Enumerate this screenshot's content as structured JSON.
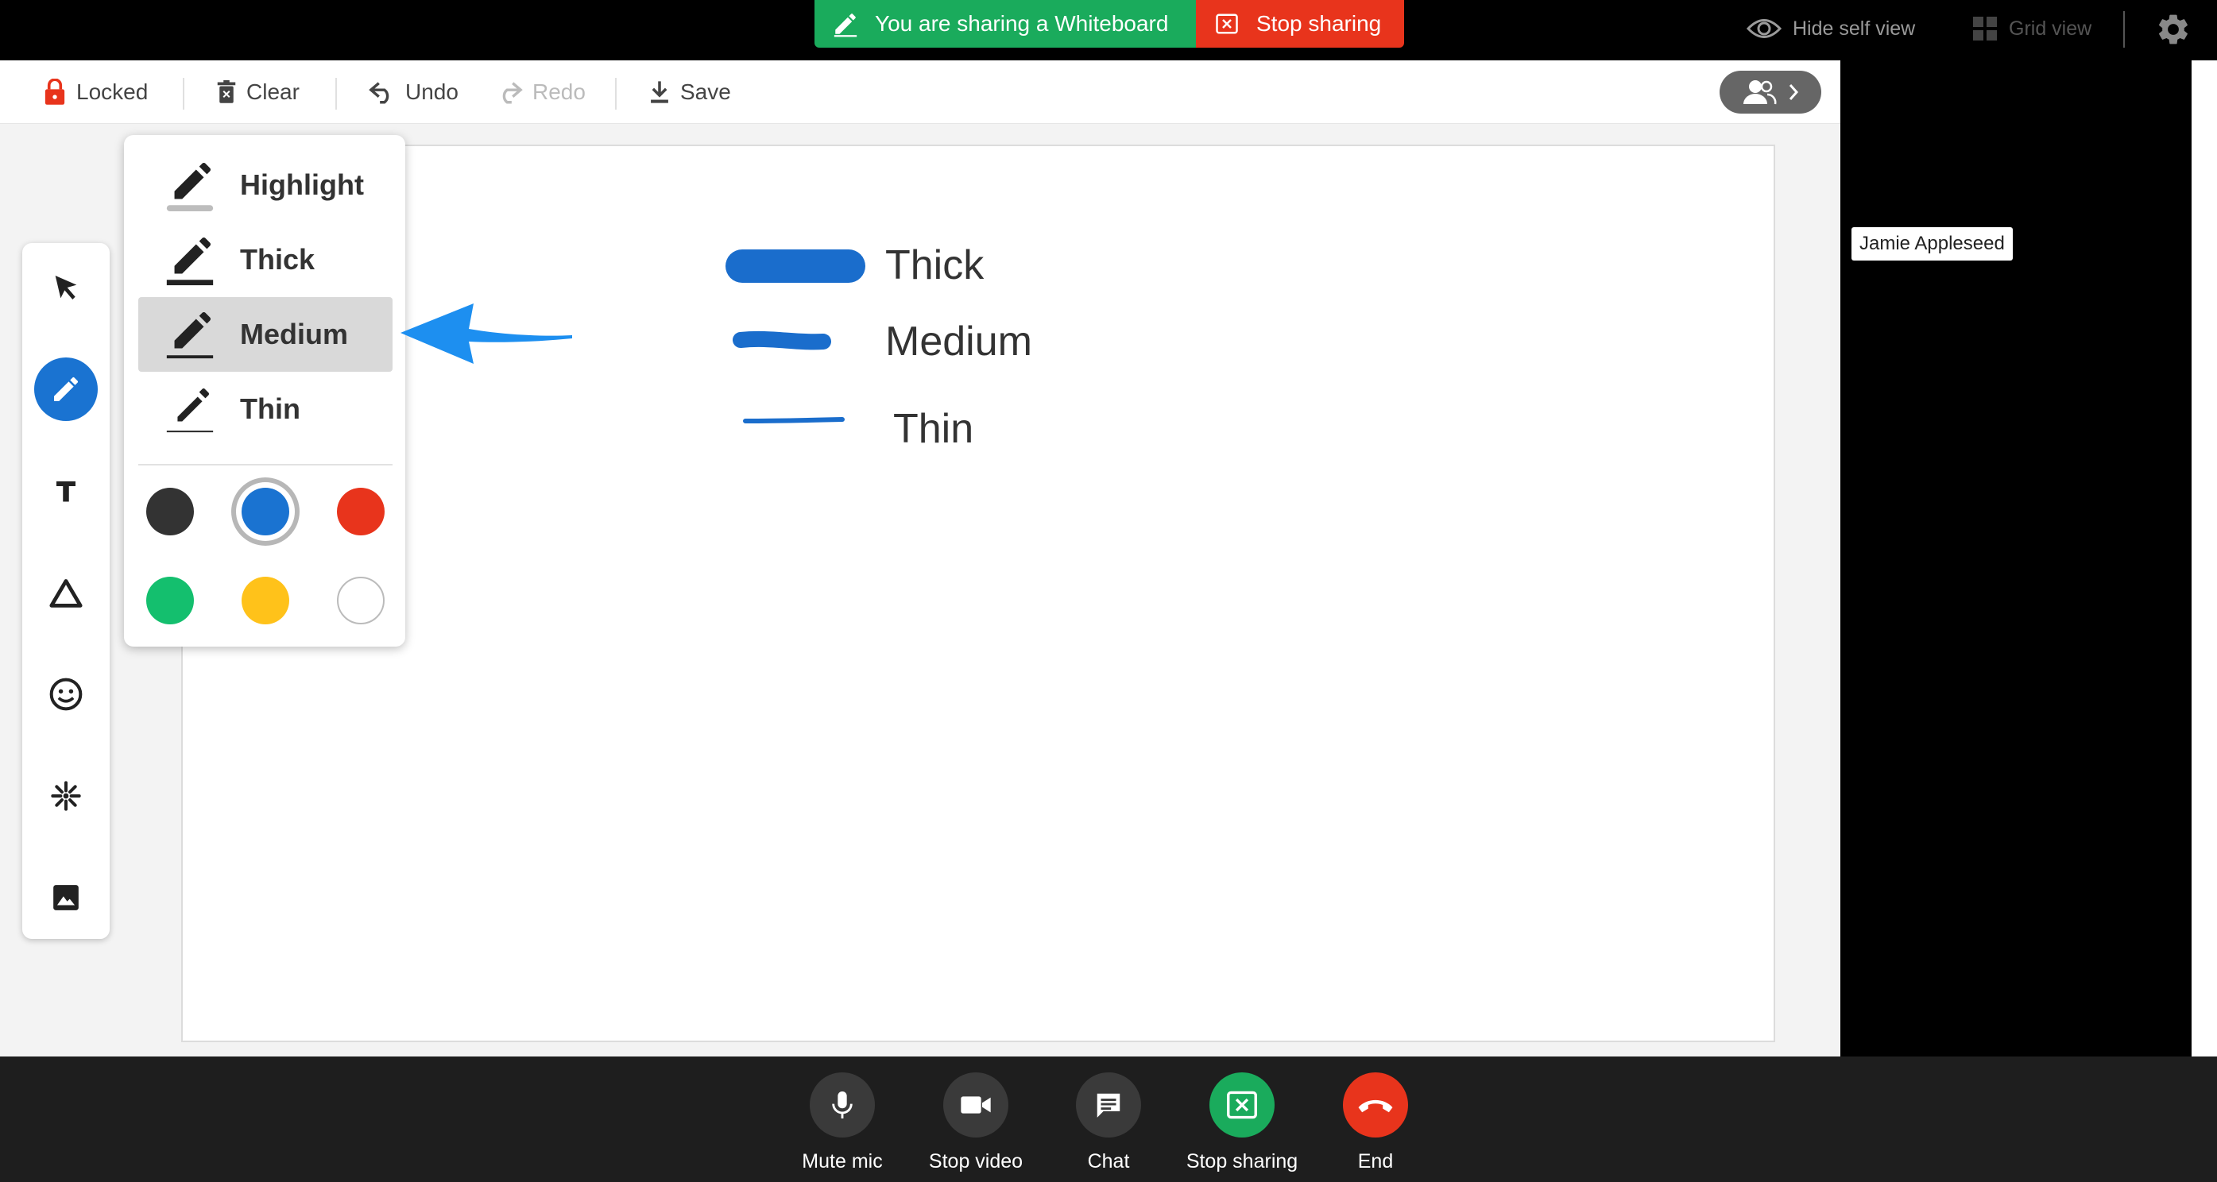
{
  "top_bar": {
    "sharing_text": "You are sharing a Whiteboard",
    "stop_sharing_label": "Stop sharing",
    "hide_self_view_label": "Hide self view",
    "grid_view_label": "Grid view"
  },
  "toolbar": {
    "locked_label": "Locked",
    "clear_label": "Clear",
    "undo_label": "Undo",
    "redo_label": "Redo",
    "save_label": "Save"
  },
  "pen_menu": {
    "options": [
      {
        "label": "Highlight",
        "icon": "highlight-pen-icon"
      },
      {
        "label": "Thick",
        "icon": "thick-pen-icon"
      },
      {
        "label": "Medium",
        "icon": "medium-pen-icon",
        "selected": true
      },
      {
        "label": "Thin",
        "icon": "thin-pen-icon"
      }
    ],
    "colors": [
      "#333333",
      "#1a73d1",
      "#e8341c",
      "#14bf6e",
      "#ffc21a",
      "#ffffff"
    ],
    "selected_color": "#1a73d1"
  },
  "board": {
    "labels": {
      "thick": "Thick",
      "medium": "Medium",
      "thin": "Thin"
    },
    "stroke_color": "#1a6dcc"
  },
  "participant": {
    "name": "Jamie Appleseed"
  },
  "bottom_controls": {
    "mute_label": "Mute mic",
    "video_label": "Stop video",
    "chat_label": "Chat",
    "stop_sharing_label": "Stop sharing",
    "end_label": "End"
  },
  "colors": {
    "share_green": "#1aab5c",
    "stop_red": "#e8341c",
    "accent_blue": "#1a73d1"
  }
}
